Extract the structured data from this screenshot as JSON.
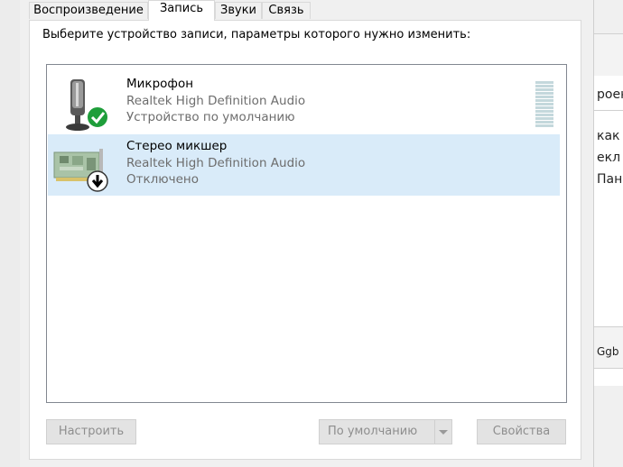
{
  "tabs": [
    {
      "label": "Воспроизведение"
    },
    {
      "label": "Запись"
    },
    {
      "label": "Звуки"
    },
    {
      "label": "Связь"
    }
  ],
  "instruction": "Выберите устройство записи, параметры которого нужно изменить:",
  "devices": [
    {
      "name": "Микрофон",
      "driver": "Realtek High Definition Audio",
      "status": "Устройство по умолчанию",
      "icon": "microphone-icon",
      "badge": "default-check-icon",
      "level": 0.0
    },
    {
      "name": "Стерео микшер",
      "driver": "Realtek High Definition Audio",
      "status": "Отключено",
      "icon": "sound-card-icon",
      "badge": "disabled-arrow-icon"
    }
  ],
  "buttons": {
    "configure": "Настроить",
    "default": "По умолчанию",
    "properties": "Свойства"
  },
  "background": {
    "line1": "роен",
    "line2": "как",
    "line3": "екл",
    "line4": "Пан",
    "line5": "Ggb"
  },
  "colors": {
    "selection": "#d9ebf9",
    "check_green": "#1e9e3a",
    "disabled_text": "#8e8e8e"
  }
}
